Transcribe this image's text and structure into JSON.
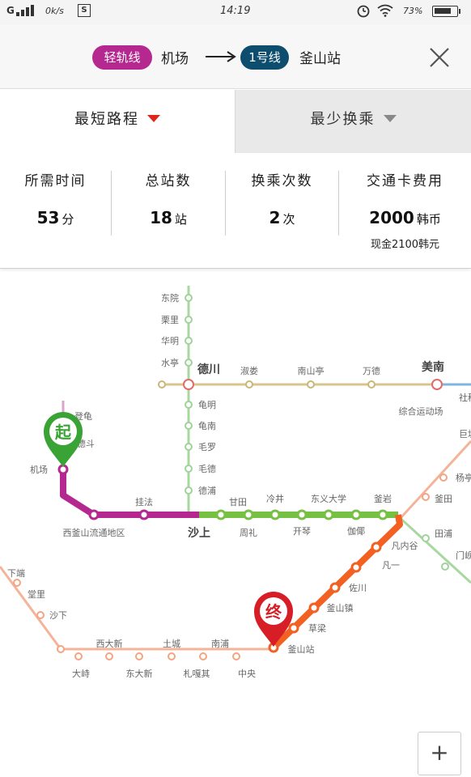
{
  "status_bar": {
    "signal": "G",
    "speed": "0k/s",
    "sim": "S",
    "time": "14:19",
    "battery": "73%",
    "battery_level": 0.73
  },
  "route": {
    "from_line": "轻轨线",
    "from_station": "机场",
    "to_line": "1号线",
    "to_station": "釜山站",
    "close_icon": "close-icon"
  },
  "tabs": [
    {
      "label": "最短路程",
      "active": true
    },
    {
      "label": "最少换乘",
      "active": false
    }
  ],
  "stats": {
    "time": {
      "label": "所需时间",
      "value": "53",
      "unit": "分"
    },
    "stations": {
      "label": "总站数",
      "value": "18",
      "unit": "站"
    },
    "transfers": {
      "label": "换乘次数",
      "value": "2",
      "unit": "次"
    },
    "fare": {
      "label": "交通卡费用",
      "value": "2000",
      "unit": "韩币",
      "cash": "现金2100韩元"
    }
  },
  "map": {
    "start_marker": "起",
    "end_marker": "终",
    "stations": {
      "dongyuan": "东院",
      "lishan": "栗里",
      "huaming": "华明",
      "shuiting": "水亭",
      "dechuan": "德川",
      "ximingmen": "淑娄",
      "nanshanting": "南山亭",
      "wande": "万德",
      "meinan": "美南",
      "shejiz": "社稷",
      "zonghe": "综合运动场",
      "juti": "巨堤",
      "gui": "登龟",
      "dengpo": "德斗",
      "jichang": "机场",
      "guinan2": "龟明",
      "guinan": "龟南",
      "maoluo": "毛罗",
      "maode": "毛德",
      "depu": "德浦",
      "guafa": "挂法",
      "xifushan": "西釜山流通地区",
      "shashang": "沙上",
      "gantian": "甘田",
      "zhouli": "周礼",
      "lengjing": "冷井",
      "kaiqin": "开琴",
      "dongyi": "东义大学",
      "jiayan": "伽倻",
      "yuyan": "釜岩",
      "fanneigu": "凡内谷",
      "fanyi": "凡一",
      "zuochuan": "佐川",
      "fushanzhen": "釜山镇",
      "caoliang": "草梁",
      "fushanzhan": "釜山站",
      "tiantian": "田浦",
      "menqian": "门岘",
      "yang": "杨亭",
      "jiatian": "釜田",
      "xiaduan": "下端",
      "tangli": "堂里",
      "shaxia": "沙下",
      "xidaxin": "西大新",
      "tucheng": "土城",
      "nanpu": "南浦",
      "dashi": "大峙",
      "dongdaxin": "东大新",
      "zhaguan": "札嘎其",
      "zhongyang": "中央"
    }
  },
  "colors": {
    "light_rail": "#b5288f",
    "line1": "#f26122",
    "line2": "#76c043",
    "line3": "#c9a94a",
    "line4": "#3d7fbf",
    "green_line_faded": "#a8d8a0",
    "start_marker": "#3aa335",
    "end_marker": "#d71e26"
  },
  "zoom_in_label": "+"
}
